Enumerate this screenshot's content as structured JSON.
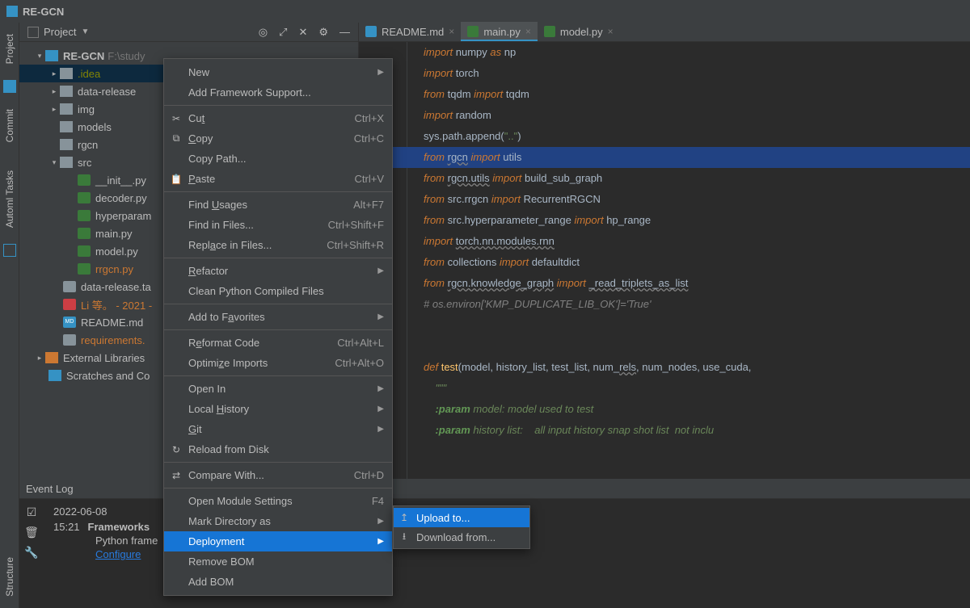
{
  "titlebar": {
    "title": "RE-GCN"
  },
  "sidebar_labels": {
    "project": "Project",
    "commit": "Commit",
    "automl": "Automl Tasks",
    "structure": "Structure"
  },
  "project_header": {
    "title": "Project"
  },
  "tree": {
    "root": {
      "name": "RE-GCN",
      "path": "F:\\study"
    },
    "idea": ".idea",
    "data_release": "data-release",
    "img": "img",
    "models": "models",
    "rgcn": "rgcn",
    "src": "src",
    "init": "__init__.py",
    "decoder": "decoder.py",
    "hyper": "hyperparam",
    "main": "main.py",
    "model": "model.py",
    "rrgcn": "rrgcn.py",
    "data_tar": "data-release.ta",
    "pdf": "Li 等。 - 2021 -",
    "readme": "README.md",
    "req": "requirements.",
    "ext": "External Libraries",
    "scratch": "Scratches and Co"
  },
  "tabs": {
    "readme": "README.md",
    "main": "main.py",
    "model": "model.py"
  },
  "context_menu": {
    "new": "New",
    "add_fw": "Add Framework Support...",
    "cut": "Cut",
    "cut_sc": "Ctrl+X",
    "copy": "Copy",
    "copy_sc": "Ctrl+C",
    "copy_path": "Copy Path...",
    "paste": "Paste",
    "paste_sc": "Ctrl+V",
    "find_usages": "Find Usages",
    "find_usages_sc": "Alt+F7",
    "find_files": "Find in Files...",
    "find_files_sc": "Ctrl+Shift+F",
    "replace_files": "Replace in Files...",
    "replace_files_sc": "Ctrl+Shift+R",
    "refactor": "Refactor",
    "clean_py": "Clean Python Compiled Files",
    "add_fav": "Add to Favorites",
    "reformat": "Reformat Code",
    "reformat_sc": "Ctrl+Alt+L",
    "optimize": "Optimize Imports",
    "optimize_sc": "Ctrl+Alt+O",
    "open_in": "Open In",
    "local_hist": "Local History",
    "git": "Git",
    "reload": "Reload from Disk",
    "compare": "Compare With...",
    "compare_sc": "Ctrl+D",
    "open_module": "Open Module Settings",
    "open_module_sc": "F4",
    "mark_dir": "Mark Directory as",
    "deployment": "Deployment",
    "remove_bom": "Remove BOM",
    "add_bom": "Add BOM"
  },
  "submenu": {
    "upload": "Upload to...",
    "download": "Download from..."
  },
  "event_log": {
    "title": "Event Log",
    "date": "2022-06-08",
    "time": "15:21",
    "msg": "Frameworks",
    "sub": "Python frame",
    "configure": "Configure"
  }
}
